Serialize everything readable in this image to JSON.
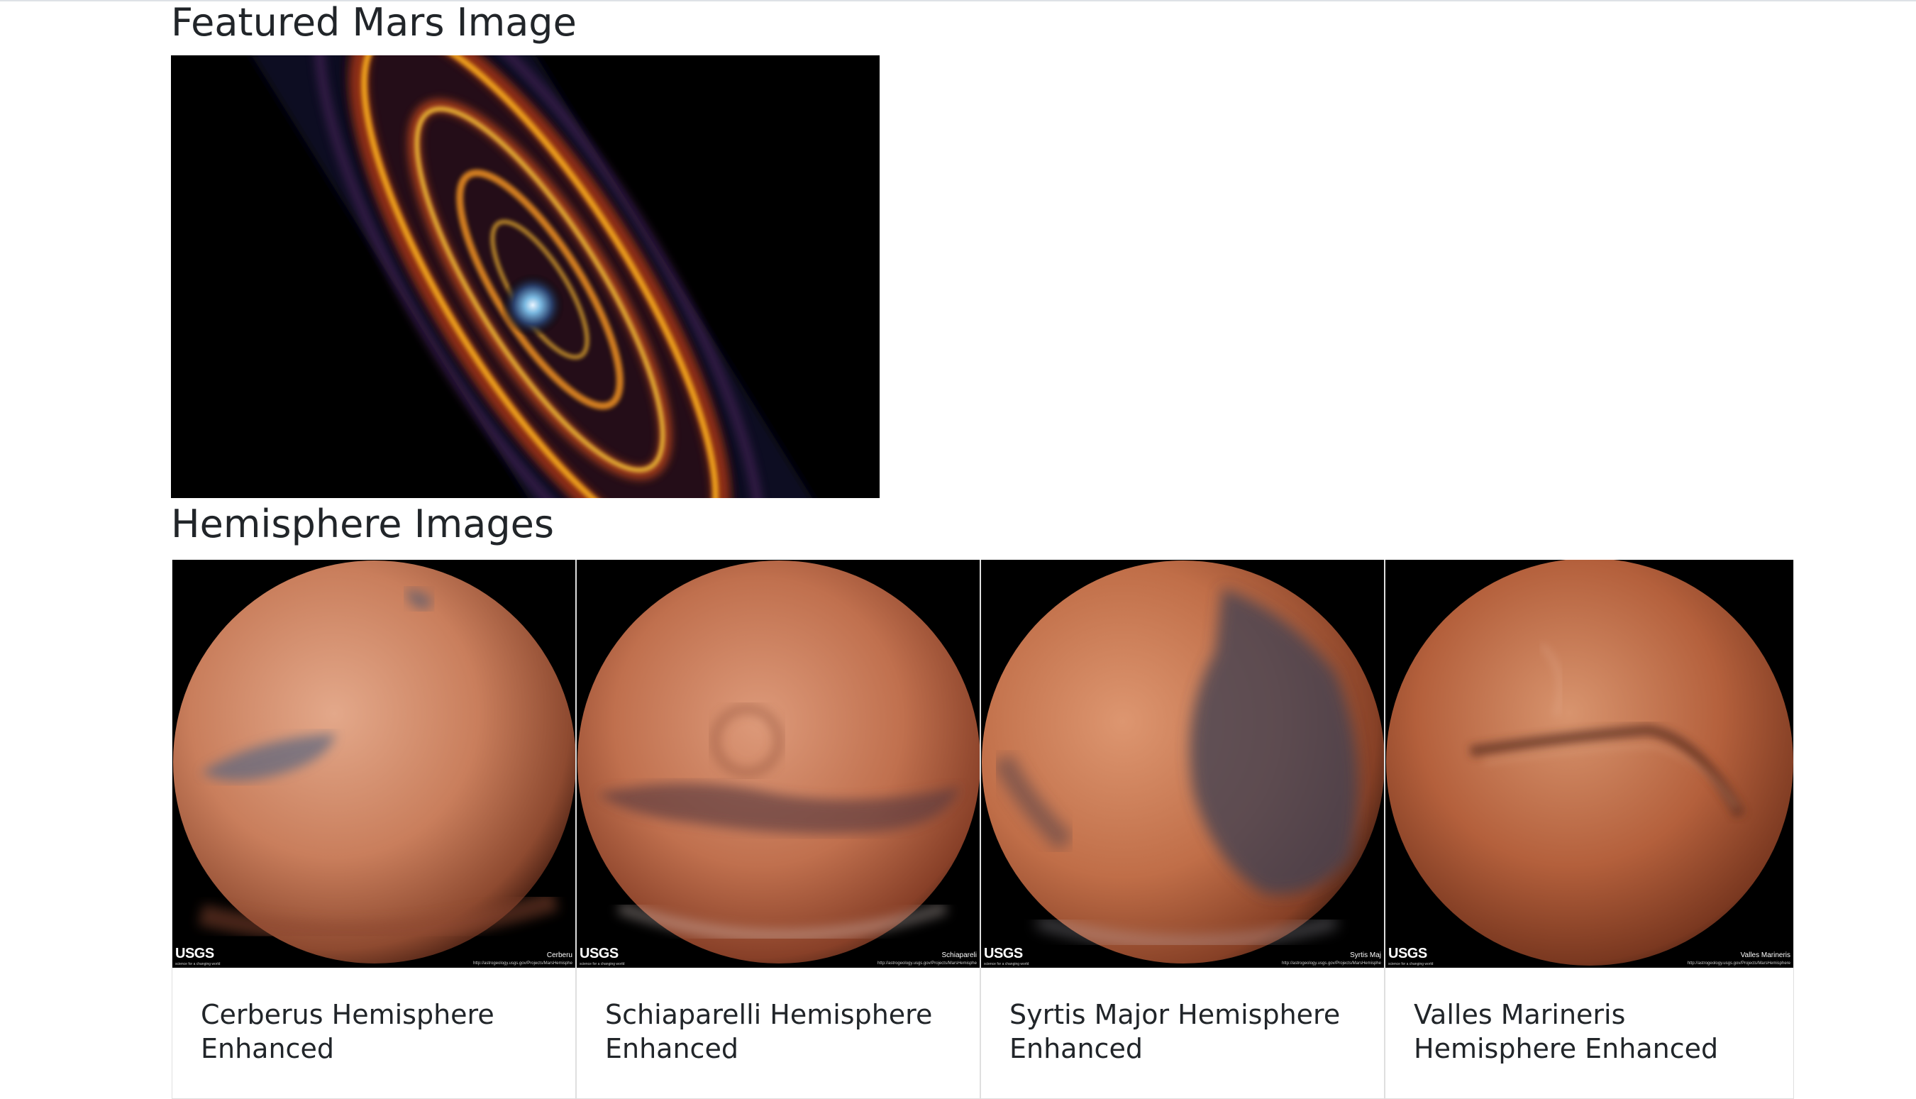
{
  "featured": {
    "title": "Featured Mars Image",
    "image_alt": "Spiral galaxy featured image"
  },
  "hemispheres": {
    "title": "Hemisphere Images",
    "brand": "USGS",
    "brand_sub": "science for a changing world",
    "items": [
      {
        "title": "Cerberus Hemisphere Enhanced",
        "label": "Cerberu",
        "url": "http://astrogeology.usgs.gov/Projects/MarsHemisphe"
      },
      {
        "title": "Schiaparelli Hemisphere Enhanced",
        "label": "Schiapareli",
        "url": "http://astrogeology.usgs.gov/Projects/MarsHemisphe"
      },
      {
        "title": "Syrtis Major Hemisphere Enhanced",
        "label": "Syrtis Maj",
        "url": "http://astrogeology.usgs.gov/Projects/MarsHemisphe"
      },
      {
        "title": "Valles Marineris Hemisphere Enhanced",
        "label": "Valles Marineris",
        "url": "http://astrogeology.usgs.gov/Projects/MarsHemisphere"
      }
    ]
  },
  "colors": {
    "text": "#212529",
    "mars_light": "#d9987a",
    "mars_mid": "#b8643f",
    "mars_dark": "#4a3a3c"
  }
}
